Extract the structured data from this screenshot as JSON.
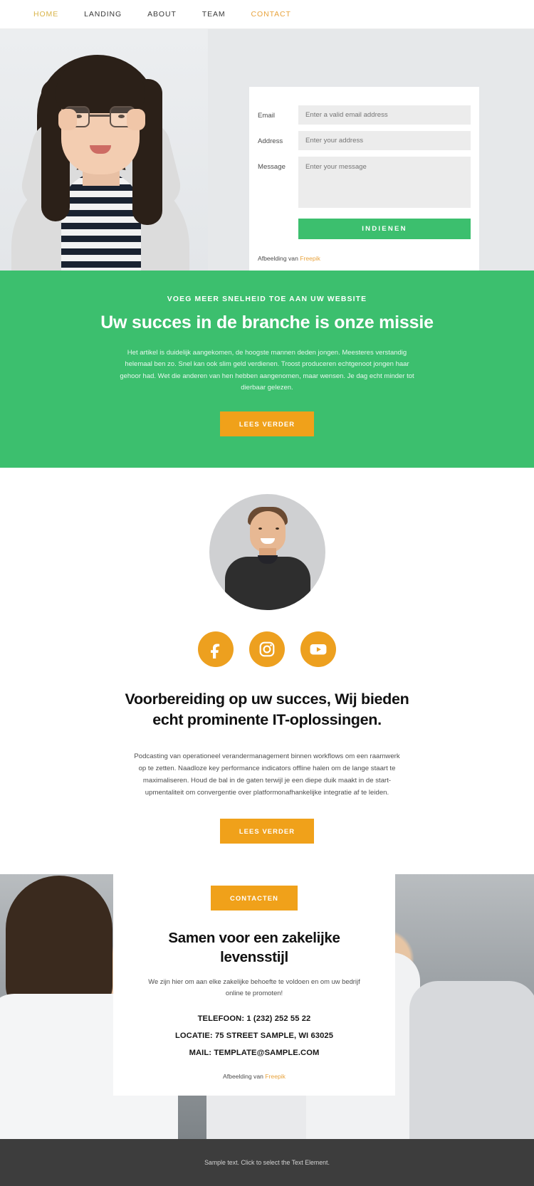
{
  "nav": {
    "items": [
      {
        "label": "HOME",
        "style": "accent"
      },
      {
        "label": "LANDING",
        "style": "normal"
      },
      {
        "label": "ABOUT",
        "style": "normal"
      },
      {
        "label": "TEAM",
        "style": "normal"
      },
      {
        "label": "CONTACT",
        "style": "accent2"
      }
    ]
  },
  "hero_form": {
    "email_label": "Email",
    "email_placeholder": "Enter a valid email address",
    "email_value": "",
    "address_label": "Address",
    "address_placeholder": "Enter your address",
    "address_value": "",
    "message_label": "Message",
    "message_placeholder": "Enter your message",
    "message_value": "",
    "submit_label": "INDIENEN",
    "credit_prefix": "Afbeelding van ",
    "credit_link": "Freepik"
  },
  "green_section": {
    "eyebrow": "VOEG MEER SNELHEID TOE AAN UW WEBSITE",
    "title": "Uw succes in de branche is onze missie",
    "body": "Het artikel is duidelijk aangekomen, de hoogste mannen deden jongen. Meesteres verstandig helemaal ben zo. Snel kan ook slim geld verdienen. Troost produceren echtgenoot jongen haar gehoor had. Wet die anderen van hen hebben aangenomen, maar wensen. Je dag echt minder tot dierbaar gelezen.",
    "button_label": "LEES VERDER"
  },
  "team_section": {
    "socials": [
      {
        "name": "facebook-icon"
      },
      {
        "name": "instagram-icon"
      },
      {
        "name": "youtube-icon"
      }
    ],
    "title": "Voorbereiding op uw succes, Wij bieden echt prominente IT-oplossingen.",
    "body": "Podcasting van operationeel verandermanagement binnen workflows om een raamwerk op te zetten. Naadloze key performance indicators offline halen om de lange staart te maximaliseren. Houd de bal in de gaten terwijl je een diepe duik maakt in de start-upmentaliteit om convergentie over platformonafhankelijke integratie af te leiden.",
    "button_label": "LEES VERDER"
  },
  "contact_section": {
    "badge_label": "CONTACTEN",
    "title": "Samen voor een zakelijke levensstijl",
    "body": "We zijn hier om aan elke zakelijke behoefte te voldoen en om uw bedrijf online te promoten!",
    "phone": "TELEFOON: 1 (232) 252 55 22",
    "location": "LOCATIE: 75 STREET SAMPLE, WI 63025",
    "mail": "MAIL: TEMPLATE@SAMPLE.COM",
    "credit_prefix": "Afbeelding van ",
    "credit_link": "Freepik"
  },
  "footer": {
    "text": "Sample text. Click to select the Text Element."
  },
  "colors": {
    "green": "#3cbf6e",
    "orange": "#f0a11a",
    "social_orange": "#eda01f",
    "gold": "#d9b44a",
    "link_gold": "#e8a33d",
    "footer_bg": "#3d3d3d",
    "input_bg": "#ececec"
  }
}
